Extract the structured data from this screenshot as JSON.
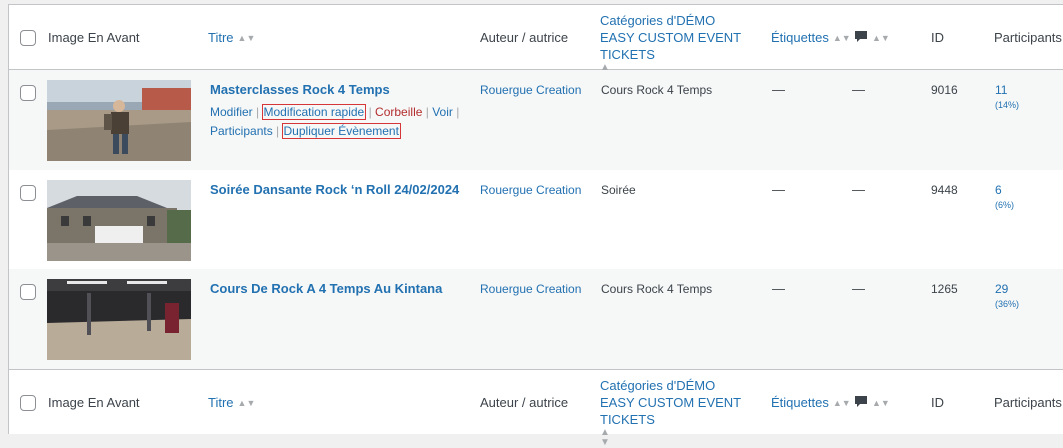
{
  "columns": {
    "image": "Image En Avant",
    "title": "Titre",
    "author": "Auteur / autrice",
    "categories": "Catégories d'DÉMO EASY CUSTOM EVENT TICKETS",
    "tags": "Étiquettes",
    "comments_icon": "comment-bubble-icon",
    "id": "ID",
    "participants": "Participants"
  },
  "row_actions": {
    "edit": "Modifier",
    "quick_edit": "Modification rapide",
    "trash": "Corbeille",
    "view": "Voir",
    "participants": "Participants",
    "duplicate": "Dupliquer Évènement",
    "sep": "|"
  },
  "rows": [
    {
      "title": "Masterclasses Rock 4 Temps",
      "author": "Rouergue Creation",
      "category": "Cours Rock 4 Temps",
      "tags": "—",
      "comments": "—",
      "id": "9016",
      "participants": "11",
      "participants_pct": "(14%)"
    },
    {
      "title": "Soirée Dansante Rock ‘n Roll 24/02/2024",
      "author": "Rouergue Creation",
      "category": "Soirée",
      "tags": "—",
      "comments": "—",
      "id": "9448",
      "participants": "6",
      "participants_pct": "(6%)"
    },
    {
      "title": "Cours De Rock A 4 Temps Au Kintana",
      "author": "Rouergue Creation",
      "category": "Cours Rock 4 Temps",
      "tags": "—",
      "comments": "—",
      "id": "1265",
      "participants": "29",
      "participants_pct": "(36%)"
    }
  ]
}
